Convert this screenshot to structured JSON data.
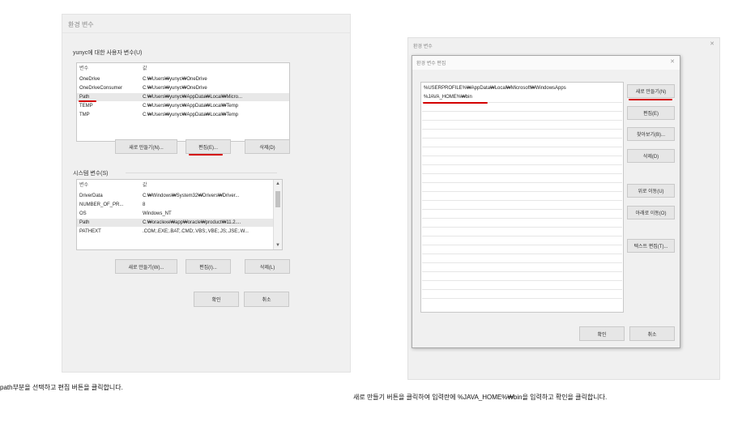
{
  "left_window": {
    "title": "환경 변수",
    "user_section_title": "yunyc에 대한 사용자 변수(U)",
    "user_table": {
      "headers": [
        "변수",
        "값"
      ],
      "rows": [
        {
          "name": "OneDrive",
          "value": "C:₩Users₩yunyc₩OneDrive"
        },
        {
          "name": "OneDriveConsumer",
          "value": "C:₩Users₩yunyc₩OneDrive"
        },
        {
          "name": "Path",
          "value": "C:₩Users₩yunyc₩AppData₩Local₩Micro..."
        },
        {
          "name": "TEMP",
          "value": "C:₩Users₩yunyc₩AppData₩Local₩Temp"
        },
        {
          "name": "TMP",
          "value": "C:₩Users₩yunyc₩AppData₩Local₩Temp"
        }
      ]
    },
    "user_buttons": {
      "new": "새로 만들기(N)...",
      "edit": "편집(E)...",
      "delete": "삭제(D)"
    },
    "system_section_title": "시스템 변수(S)",
    "system_table": {
      "headers": [
        "변수",
        "값"
      ],
      "rows": [
        {
          "name": "DriverData",
          "value": "C:₩Windows₩System32₩Drivers₩Driver..."
        },
        {
          "name": "NUMBER_OF_PR...",
          "value": "8"
        },
        {
          "name": "OS",
          "value": "Windows_NT"
        },
        {
          "name": "Path",
          "value": "C:₩oraclexe₩app₩oracle₩product₩11.2...."
        },
        {
          "name": "PATHEXT",
          "value": ".COM;.EXE;.BAT;.CMD;.VBS;.VBE;.JS;.JSE;.W..."
        }
      ]
    },
    "system_buttons": {
      "new": "새로 만들기(W)...",
      "edit": "편집(I)...",
      "delete": "삭제(L)"
    },
    "ok": "확인",
    "cancel": "취소"
  },
  "right_window": {
    "outer_title": "환경 변수",
    "outer_close": "✕",
    "dialog_title": "환경 변수 편집",
    "dialog_close": "✕",
    "paths": [
      "%USERPROFILE%₩AppData₩Local₩Microsoft₩WindowsApps",
      "%JAVA_HOME%₩bin"
    ],
    "buttons": {
      "new": "새로 만들기(N)",
      "edit": "편집(E)",
      "browse": "찾아보기(B)...",
      "delete": "삭제(D)",
      "move_up": "위로 이동(U)",
      "move_down": "아래로 이동(O)",
      "edit_text": "텍스트 편집(T)..."
    },
    "ok": "확인",
    "cancel": "취소"
  },
  "captions": {
    "left": "path부분을 선택하고 편집 버튼을 클릭합니다.",
    "right": "새로 만들기 버튼을 클릭하여 입력란에 %JAVA_HOME%₩bin을 입력하고 확인을 클릭합니다."
  },
  "colors": {
    "underline": "#d40000",
    "window_bg": "#f0f0f0"
  }
}
